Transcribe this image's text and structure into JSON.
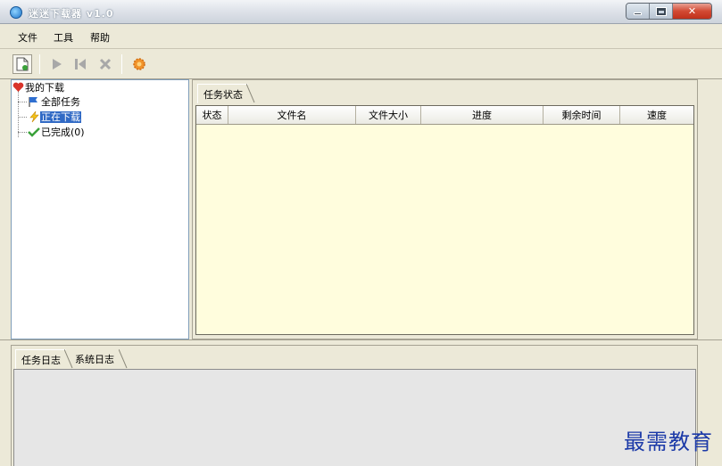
{
  "window": {
    "title": "迷迷下载器 v1.0"
  },
  "menu": [
    {
      "label": "文件"
    },
    {
      "label": "工具"
    },
    {
      "label": "帮助"
    }
  ],
  "toolbar": {
    "icons": [
      "new-task-icon",
      "start-icon",
      "pause-icon",
      "delete-icon",
      "settings-icon"
    ]
  },
  "tree": {
    "root": "我的下载",
    "children": [
      {
        "label": "全部任务",
        "icon": "flag-icon"
      },
      {
        "label": "正在下载",
        "icon": "lightning-icon",
        "selected": true
      },
      {
        "label": "已完成(0)",
        "icon": "checkmark-icon"
      }
    ]
  },
  "task_tabs": [
    {
      "label": "任务状态",
      "active": true
    }
  ],
  "table": {
    "columns": [
      "状态",
      "文件名",
      "文件大小",
      "进度",
      "剩余时间",
      "速度"
    ],
    "rows": []
  },
  "log_tabs": [
    {
      "label": "任务日志",
      "active": true
    },
    {
      "label": "系统日志",
      "active": false
    }
  ],
  "watermark": "最需教育",
  "colors": {
    "grid_bg": "#fffddd",
    "selection": "#316ac5",
    "watermark": "#1c3aa8"
  }
}
